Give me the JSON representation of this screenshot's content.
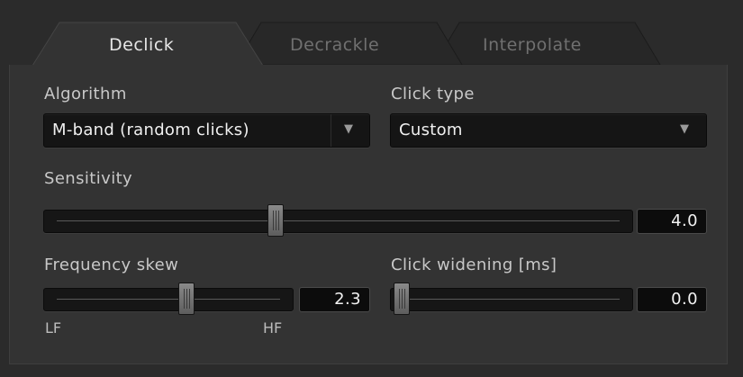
{
  "tabs": [
    {
      "label": "Declick",
      "active": true
    },
    {
      "label": "Decrackle",
      "active": false
    },
    {
      "label": "Interpolate",
      "active": false
    }
  ],
  "algorithm": {
    "label": "Algorithm",
    "value": "M-band (random clicks)"
  },
  "click_type": {
    "label": "Click type",
    "value": "Custom"
  },
  "sensitivity": {
    "label": "Sensitivity",
    "value": "4.0",
    "fraction": 0.39
  },
  "frequency_skew": {
    "label": "Frequency skew",
    "value": "2.3",
    "fraction": 0.58,
    "min_label": "LF",
    "max_label": "HF"
  },
  "click_widening": {
    "label": "Click widening [ms]",
    "value": "0.0",
    "fraction": 0.0
  },
  "icons": {
    "dropdown": "chevron-down-icon"
  },
  "colors": {
    "background": "#2b2b2b",
    "panel": "#333333",
    "field": "#151515",
    "text": "#d6d6d6"
  }
}
